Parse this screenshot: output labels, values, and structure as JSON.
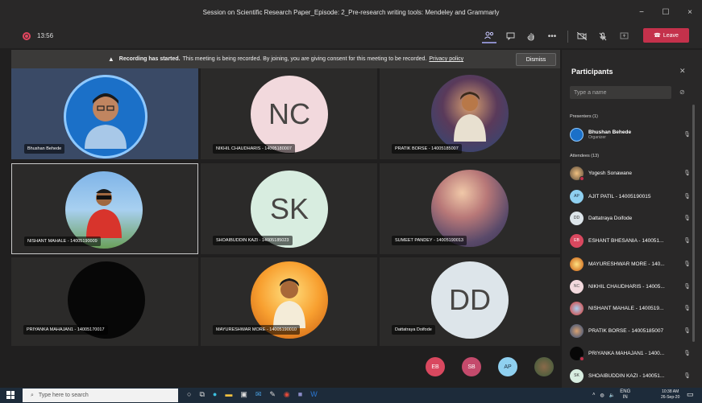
{
  "window": {
    "title": "Session on Scientific Research Paper_Episode: 2_Pre-research writing tools: Mendeley and Grammarly",
    "minimize": "−",
    "maximize": "☐",
    "close": "×"
  },
  "toolbar": {
    "timer": "13:56",
    "leave_label": "Leave"
  },
  "banner": {
    "bold": "Recording has started.",
    "text": "This meeting is being recorded. By joining, you are giving consent for this meeting to be recorded.",
    "link": "Privacy policy",
    "dismiss": "Dismiss"
  },
  "tiles": [
    {
      "name": "Bhushan Behede",
      "initials": ""
    },
    {
      "name": "NIKHIL CHAUDHARIS - 14005180007",
      "initials": "NC"
    },
    {
      "name": "PRATIK BORSE - 14005185007",
      "initials": ""
    },
    {
      "name": "NISHANT MAHALE - 14005190009",
      "initials": ""
    },
    {
      "name": "SHOAIBUDDIN KAZI - 14005185023",
      "initials": "SK"
    },
    {
      "name": "SUMEET PANDEY - 14005190013",
      "initials": ""
    },
    {
      "name": "PRIYANKA MAHAJAN1 - 14005170017",
      "initials": ""
    },
    {
      "name": "MAYURESHWAR MORE - 14005190010",
      "initials": ""
    },
    {
      "name": "Dattatraya Doifode",
      "initials": "DD"
    }
  ],
  "overflow": [
    "EB",
    "SB",
    "AP"
  ],
  "participants": {
    "title": "Participants",
    "search_placeholder": "Type a name",
    "presenters_label": "Presenters (1)",
    "presenter": {
      "name": "Bhushan Behede",
      "role": "Organizer"
    },
    "attendees_label": "Attendees (13)",
    "attendees": [
      {
        "name": "Yogesh Sonawane",
        "initials": ""
      },
      {
        "name": "AJIT PATIL - 14005190015",
        "initials": "AP"
      },
      {
        "name": "Dattatraya Doifode",
        "initials": "DD"
      },
      {
        "name": "ESHANT BHESANIA - 140051...",
        "initials": "EB"
      },
      {
        "name": "MAYURESHWAR MORE - 140...",
        "initials": ""
      },
      {
        "name": "NIKHIL CHAUDHARIS - 14005...",
        "initials": "NC"
      },
      {
        "name": "NISHANT MAHALE - 1400519...",
        "initials": ""
      },
      {
        "name": "PRATIK BORSE - 14005185007",
        "initials": ""
      },
      {
        "name": "PRIYANKA MAHAJAN1 - 1400...",
        "initials": ""
      },
      {
        "name": "SHOAIBUDDIN KAZI - 140051...",
        "initials": "SK"
      }
    ]
  },
  "taskbar": {
    "search_placeholder": "Type here to search",
    "lang": "ENG",
    "region": "IN",
    "time": "10:38 AM",
    "date": "26-Sep-20"
  }
}
